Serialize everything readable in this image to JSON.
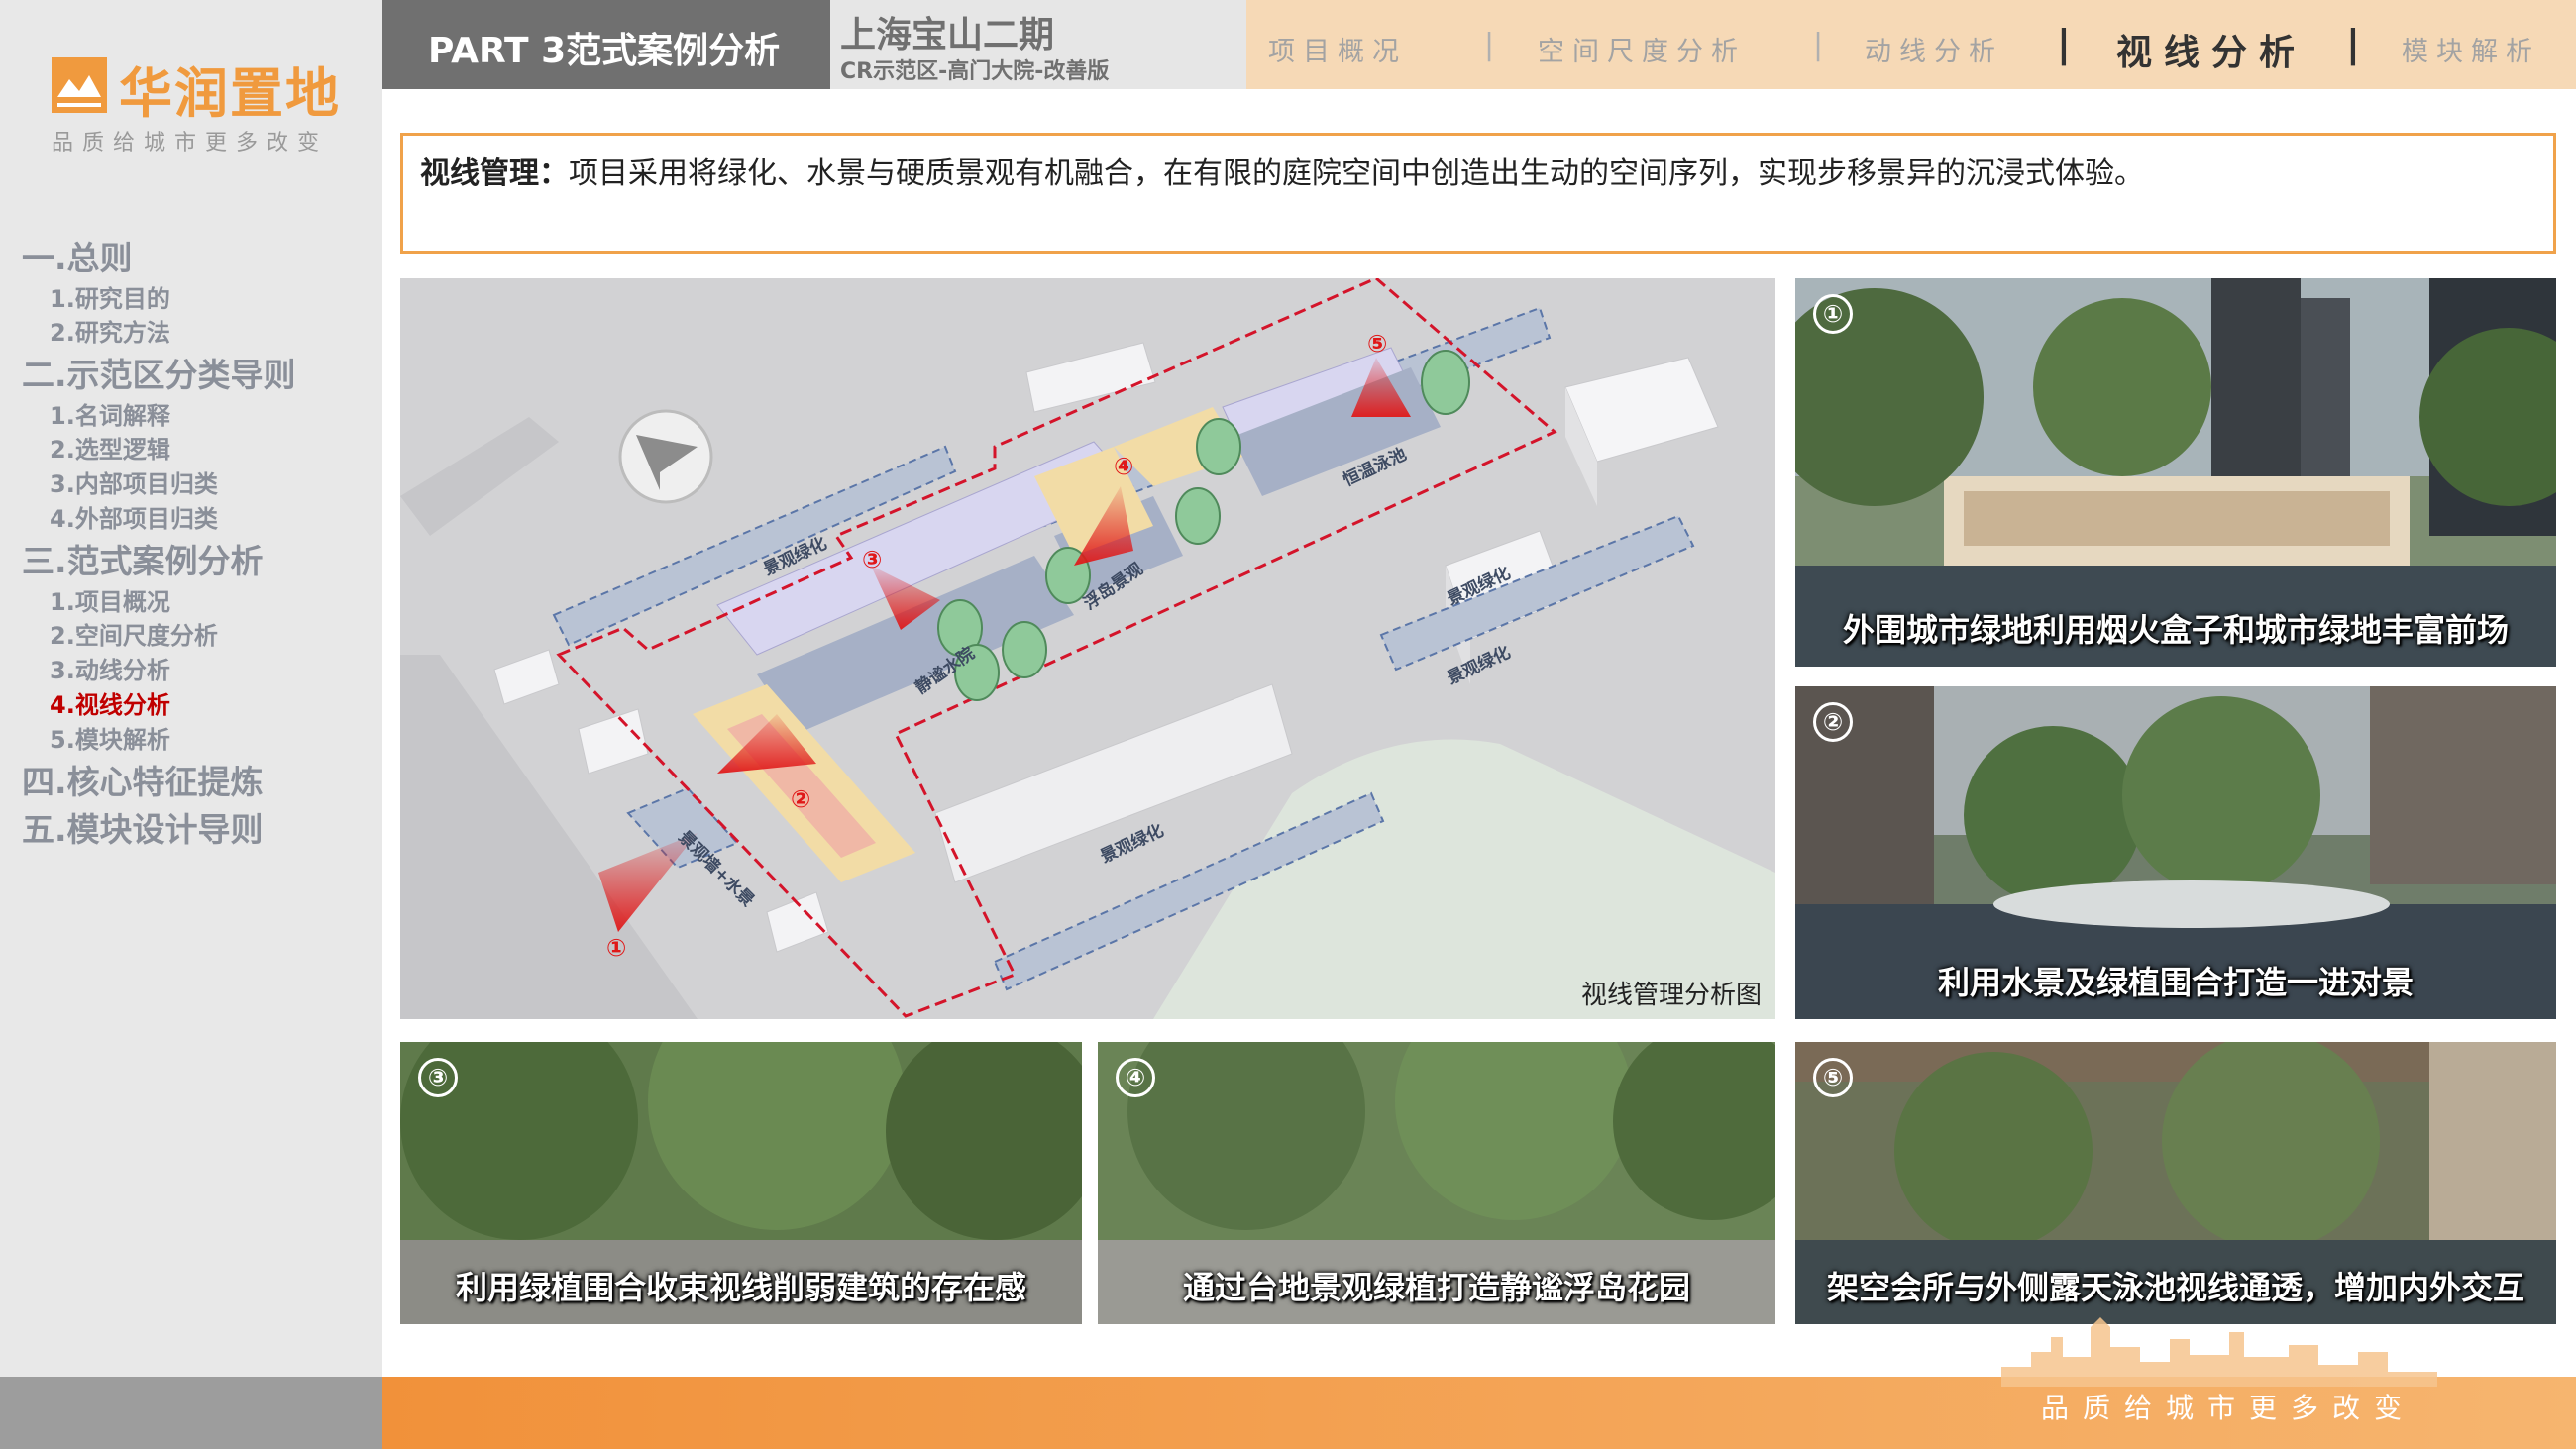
{
  "brand": {
    "name": "华润置地",
    "slogan": "品质给城市更多改变",
    "colors": {
      "accent_orange": "#f0a24a",
      "active_red": "#c00000",
      "header_gray": "#707070",
      "tab_bar": "#f6d9b6"
    }
  },
  "nav": {
    "sections": [
      {
        "label": "一.总则",
        "items": [
          {
            "label": "1.研究目的"
          },
          {
            "label": "2.研究方法"
          }
        ]
      },
      {
        "label": "二.示范区分类导则",
        "items": [
          {
            "label": "1.名词解释"
          },
          {
            "label": "2.选型逻辑"
          },
          {
            "label": "3.内部项目归类"
          },
          {
            "label": "4.外部项目归类"
          }
        ]
      },
      {
        "label": "三.范式案例分析",
        "items": [
          {
            "label": "1.项目概况"
          },
          {
            "label": "2.空间尺度分析"
          },
          {
            "label": "3.动线分析"
          },
          {
            "label": "4.视线分析",
            "active": true
          },
          {
            "label": "5.模块解析"
          }
        ]
      },
      {
        "label": "四.核心特征提炼",
        "items": []
      },
      {
        "label": "五.模块设计导则",
        "items": []
      }
    ]
  },
  "header": {
    "part": "PART 3范式案例分析",
    "project_title": "上海宝山二期",
    "project_subtitle": "CR示范区-高门大院-改善版",
    "tabs": [
      {
        "label": "项目概况"
      },
      {
        "label": "空间尺度分析"
      },
      {
        "label": "动线分析"
      },
      {
        "label": "视线分析",
        "active": true
      },
      {
        "label": "模块解析"
      }
    ]
  },
  "intro": {
    "label": "视线管理：",
    "text": "项目采用将绿化、水景与硬质景观有机融合，在有限的庭院空间中创造出生动的空间序列，实现步移景异的沉浸式体验。"
  },
  "diagram": {
    "caption": "视线管理分析图",
    "labels": {
      "landscape_green_1": "景观绿化",
      "landscape_green_2": "景观绿化",
      "landscape_green_3": "景观绿化",
      "landscape_green_4": "景观绿化",
      "wall_water": "景观墙+水景",
      "quiet_courtyard": "静谧水院",
      "floating_island": "浮岛景观",
      "pool": "恒温泳池"
    },
    "viewpoints": [
      "①",
      "②",
      "③",
      "④",
      "⑤"
    ]
  },
  "photos": [
    {
      "num": "①",
      "caption": "外围城市绿地利用烟火盒子和城市绿地丰富前场"
    },
    {
      "num": "②",
      "caption": "利用水景及绿植围合打造一进对景"
    },
    {
      "num": "③",
      "caption": "利用绿植围合收束视线削弱建筑的存在感"
    },
    {
      "num": "④",
      "caption": "通过台地景观绿植打造静谧浮岛花园"
    },
    {
      "num": "⑤",
      "caption": "架空会所与外侧露天泳池视线通透，增加内外交互"
    }
  ]
}
